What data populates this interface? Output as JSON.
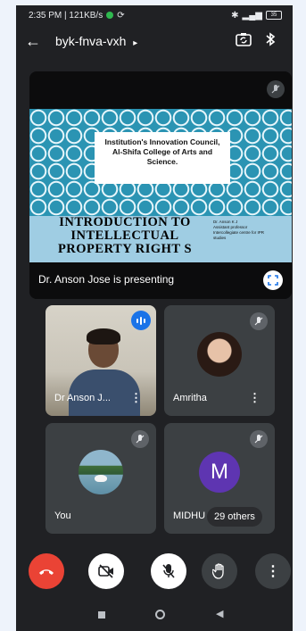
{
  "status_bar": {
    "time_speed": "2:35 PM | 121KB/s",
    "battery": "35"
  },
  "header": {
    "meeting_code": "byk-fnva-vxh",
    "chevron": "▸",
    "icons": [
      "back-arrow-icon",
      "switch-camera-icon",
      "bluetooth-icon"
    ]
  },
  "presentation": {
    "slide_header_lines": [
      "Institution's Innovation Council,",
      "Al-Shifa College of Arts and",
      "Science."
    ],
    "slide_title_lines": [
      "INTRODUCTION TO",
      "INTELLECTUAL",
      "PROPERTY RIGHT S"
    ],
    "slide_presenter_lines": [
      "Dr. Anson K J",
      "Assistant professor",
      "Intercollegiate centre for IPR",
      "studies"
    ],
    "caption": "Dr. Anson Jose is presenting"
  },
  "participants": [
    {
      "name": "Dr Anson J...",
      "state": "speaking",
      "video": true
    },
    {
      "name": "Amritha",
      "state": "muted",
      "video": false
    },
    {
      "name": "You",
      "state": "muted",
      "video": false
    },
    {
      "name": "MIDHU",
      "state": "muted",
      "video": false,
      "avatar_letter": "M",
      "others_label": "29 others"
    }
  ],
  "controls": [
    "end-call",
    "camera-off",
    "mic-off",
    "raise-hand",
    "more-options"
  ],
  "colors": {
    "end_call": "#ea4335",
    "speaking": "#1a73e8",
    "avatar_m": "#5e35b1",
    "tile": "#3c4043"
  }
}
